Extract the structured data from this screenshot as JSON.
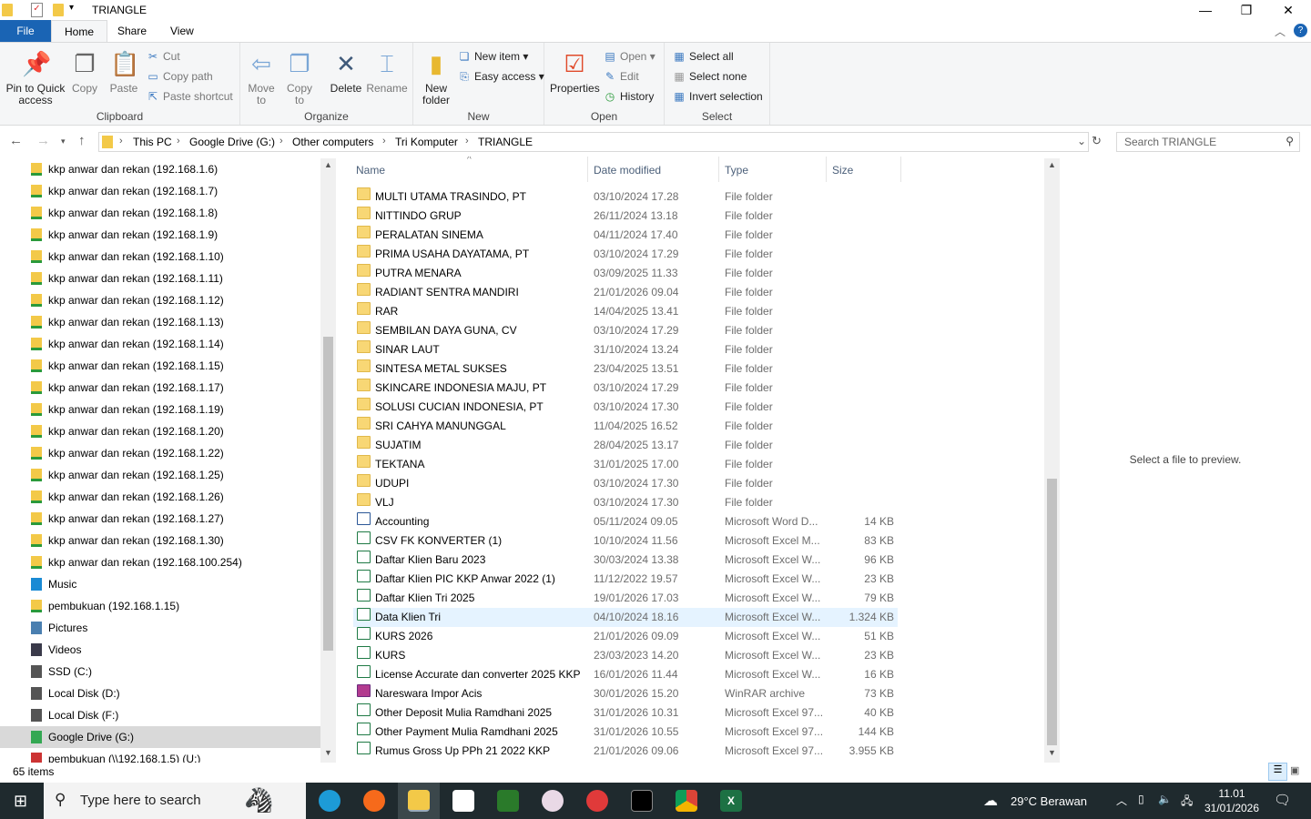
{
  "window": {
    "title": "TRIANGLE",
    "minimize": "—",
    "maximize": "❐",
    "close": "✕"
  },
  "tabs": {
    "file": "File",
    "home": "Home",
    "share": "Share",
    "view": "View"
  },
  "ribbon": {
    "clipboard": {
      "label": "Clipboard",
      "pin": "Pin to Quick access",
      "copy": "Copy",
      "paste": "Paste",
      "cut": "Cut",
      "copy_path": "Copy path",
      "paste_shortcut": "Paste shortcut"
    },
    "organize": {
      "label": "Organize",
      "move_to": "Move to",
      "copy_to": "Copy to",
      "delete": "Delete",
      "rename": "Rename"
    },
    "new": {
      "label": "New",
      "new_folder": "New folder",
      "new_item": "New item ▾",
      "easy_access": "Easy access ▾"
    },
    "open": {
      "label": "Open",
      "properties": "Properties",
      "open": "Open ▾",
      "edit": "Edit",
      "history": "History"
    },
    "select": {
      "label": "Select",
      "select_all": "Select all",
      "select_none": "Select none",
      "invert": "Invert selection"
    }
  },
  "address": {
    "crumbs": [
      "This PC",
      "Google Drive (G:)",
      "Other computers",
      "Tri Komputer",
      "TRIANGLE"
    ],
    "search_placeholder": "Search TRIANGLE"
  },
  "nav": [
    {
      "label": "kkp anwar dan rekan (192.168.1.6)",
      "icon": "network-drive"
    },
    {
      "label": "kkp anwar dan rekan (192.168.1.7)",
      "icon": "network-drive"
    },
    {
      "label": "kkp anwar dan rekan (192.168.1.8)",
      "icon": "network-drive"
    },
    {
      "label": "kkp anwar dan rekan (192.168.1.9)",
      "icon": "network-drive"
    },
    {
      "label": "kkp anwar dan rekan (192.168.1.10)",
      "icon": "network-drive"
    },
    {
      "label": "kkp anwar dan rekan (192.168.1.11)",
      "icon": "network-drive"
    },
    {
      "label": "kkp anwar dan rekan (192.168.1.12)",
      "icon": "network-drive"
    },
    {
      "label": "kkp anwar dan rekan (192.168.1.13)",
      "icon": "network-drive"
    },
    {
      "label": "kkp anwar dan rekan (192.168.1.14)",
      "icon": "network-drive"
    },
    {
      "label": "kkp anwar dan rekan (192.168.1.15)",
      "icon": "network-drive"
    },
    {
      "label": "kkp anwar dan rekan (192.168.1.17)",
      "icon": "network-drive"
    },
    {
      "label": "kkp anwar dan rekan (192.168.1.19)",
      "icon": "network-drive"
    },
    {
      "label": "kkp anwar dan rekan (192.168.1.20)",
      "icon": "network-drive"
    },
    {
      "label": "kkp anwar dan rekan (192.168.1.22)",
      "icon": "network-drive"
    },
    {
      "label": "kkp anwar dan rekan (192.168.1.25)",
      "icon": "network-drive"
    },
    {
      "label": "kkp anwar dan rekan (192.168.1.26)",
      "icon": "network-drive"
    },
    {
      "label": "kkp anwar dan rekan (192.168.1.27)",
      "icon": "network-drive"
    },
    {
      "label": "kkp anwar dan rekan (192.168.1.30)",
      "icon": "network-drive"
    },
    {
      "label": "kkp anwar dan rekan (192.168.100.254)",
      "icon": "network-drive"
    },
    {
      "label": "Music",
      "icon": "music"
    },
    {
      "label": "pembukuan (192.168.1.15)",
      "icon": "network-drive"
    },
    {
      "label": "Pictures",
      "icon": "pictures"
    },
    {
      "label": "Videos",
      "icon": "videos"
    },
    {
      "label": "SSD (C:)",
      "icon": "drive"
    },
    {
      "label": "Local Disk (D:)",
      "icon": "drive"
    },
    {
      "label": "Local Disk (F:)",
      "icon": "drive"
    },
    {
      "label": "Google Drive (G:)",
      "icon": "google-drive",
      "selected": true
    },
    {
      "label": "pembukuan (\\\\192.168.1.5) (U:)",
      "icon": "network-drive-red"
    }
  ],
  "columns": {
    "name": "Name",
    "date": "Date modified",
    "type": "Type",
    "size": "Size"
  },
  "files": [
    {
      "name": "MULTI UTAMA TRASINDO, PT",
      "date": "03/10/2024 17.28",
      "type": "File folder",
      "size": "",
      "icon": "folder"
    },
    {
      "name": "NITTINDO GRUP",
      "date": "26/11/2024 13.18",
      "type": "File folder",
      "size": "",
      "icon": "folder"
    },
    {
      "name": "PERALATAN SINEMA",
      "date": "04/11/2024 17.40",
      "type": "File folder",
      "size": "",
      "icon": "folder"
    },
    {
      "name": "PRIMA USAHA DAYATAMA, PT",
      "date": "03/10/2024 17.29",
      "type": "File folder",
      "size": "",
      "icon": "folder"
    },
    {
      "name": "PUTRA MENARA",
      "date": "03/09/2025 11.33",
      "type": "File folder",
      "size": "",
      "icon": "folder"
    },
    {
      "name": "RADIANT SENTRA MANDIRI",
      "date": "21/01/2026 09.04",
      "type": "File folder",
      "size": "",
      "icon": "folder"
    },
    {
      "name": "RAR",
      "date": "14/04/2025 13.41",
      "type": "File folder",
      "size": "",
      "icon": "folder"
    },
    {
      "name": "SEMBILAN DAYA GUNA, CV",
      "date": "03/10/2024 17.29",
      "type": "File folder",
      "size": "",
      "icon": "folder"
    },
    {
      "name": "SINAR LAUT",
      "date": "31/10/2024 13.24",
      "type": "File folder",
      "size": "",
      "icon": "folder"
    },
    {
      "name": "SINTESA METAL SUKSES",
      "date": "23/04/2025 13.51",
      "type": "File folder",
      "size": "",
      "icon": "folder"
    },
    {
      "name": "SKINCARE INDONESIA MAJU, PT",
      "date": "03/10/2024 17.29",
      "type": "File folder",
      "size": "",
      "icon": "folder"
    },
    {
      "name": "SOLUSI CUCIAN INDONESIA, PT",
      "date": "03/10/2024 17.30",
      "type": "File folder",
      "size": "",
      "icon": "folder"
    },
    {
      "name": "SRI CAHYA MANUNGGAL",
      "date": "11/04/2025 16.52",
      "type": "File folder",
      "size": "",
      "icon": "folder"
    },
    {
      "name": "SUJATIM",
      "date": "28/04/2025 13.17",
      "type": "File folder",
      "size": "",
      "icon": "folder"
    },
    {
      "name": "TEKTANA",
      "date": "31/01/2025 17.00",
      "type": "File folder",
      "size": "",
      "icon": "folder"
    },
    {
      "name": "UDUPI",
      "date": "03/10/2024 17.30",
      "type": "File folder",
      "size": "",
      "icon": "folder"
    },
    {
      "name": "VLJ",
      "date": "03/10/2024 17.30",
      "type": "File folder",
      "size": "",
      "icon": "folder"
    },
    {
      "name": "Accounting",
      "date": "05/11/2024 09.05",
      "type": "Microsoft Word D...",
      "size": "14 KB",
      "icon": "doc"
    },
    {
      "name": "CSV FK KONVERTER (1)",
      "date": "10/10/2024 11.56",
      "type": "Microsoft Excel M...",
      "size": "83 KB",
      "icon": "xls"
    },
    {
      "name": "Daftar Klien Baru 2023",
      "date": "30/03/2024 13.38",
      "type": "Microsoft Excel W...",
      "size": "96 KB",
      "icon": "xls"
    },
    {
      "name": "Daftar Klien PIC KKP Anwar 2022 (1)",
      "date": "11/12/2022 19.57",
      "type": "Microsoft Excel W...",
      "size": "23 KB",
      "icon": "xls"
    },
    {
      "name": "Daftar Klien Tri 2025",
      "date": "19/01/2026 17.03",
      "type": "Microsoft Excel W...",
      "size": "79 KB",
      "icon": "xls"
    },
    {
      "name": "Data Klien Tri",
      "date": "04/10/2024 18.16",
      "type": "Microsoft Excel W...",
      "size": "1.324 KB",
      "icon": "xls",
      "selected": true
    },
    {
      "name": "KURS 2026",
      "date": "21/01/2026 09.09",
      "type": "Microsoft Excel W...",
      "size": "51 KB",
      "icon": "xls"
    },
    {
      "name": "KURS",
      "date": "23/03/2023 14.20",
      "type": "Microsoft Excel W...",
      "size": "23 KB",
      "icon": "xls"
    },
    {
      "name": "License Accurate  dan converter 2025 KKP",
      "date": "16/01/2026 11.44",
      "type": "Microsoft Excel W...",
      "size": "16 KB",
      "icon": "xls"
    },
    {
      "name": "Nareswara Impor Acis",
      "date": "30/01/2026 15.20",
      "type": "WinRAR archive",
      "size": "73 KB",
      "icon": "rar"
    },
    {
      "name": "Other Deposit Mulia Ramdhani 2025",
      "date": "31/01/2026 10.31",
      "type": "Microsoft Excel 97...",
      "size": "40 KB",
      "icon": "xls"
    },
    {
      "name": "Other Payment Mulia Ramdhani 2025",
      "date": "31/01/2026 10.55",
      "type": "Microsoft Excel 97...",
      "size": "144 KB",
      "icon": "xls"
    },
    {
      "name": "Rumus Gross Up PPh 21 2022 KKP",
      "date": "21/01/2026 09.06",
      "type": "Microsoft Excel 97...",
      "size": "3.955 KB",
      "icon": "xls"
    }
  ],
  "preview": "Select a file to preview.",
  "status": "65 items",
  "taskbar": {
    "search_placeholder": "Type here to search",
    "weather": "29°C  Berawan",
    "time": "11.01",
    "date": "31/01/2026"
  }
}
